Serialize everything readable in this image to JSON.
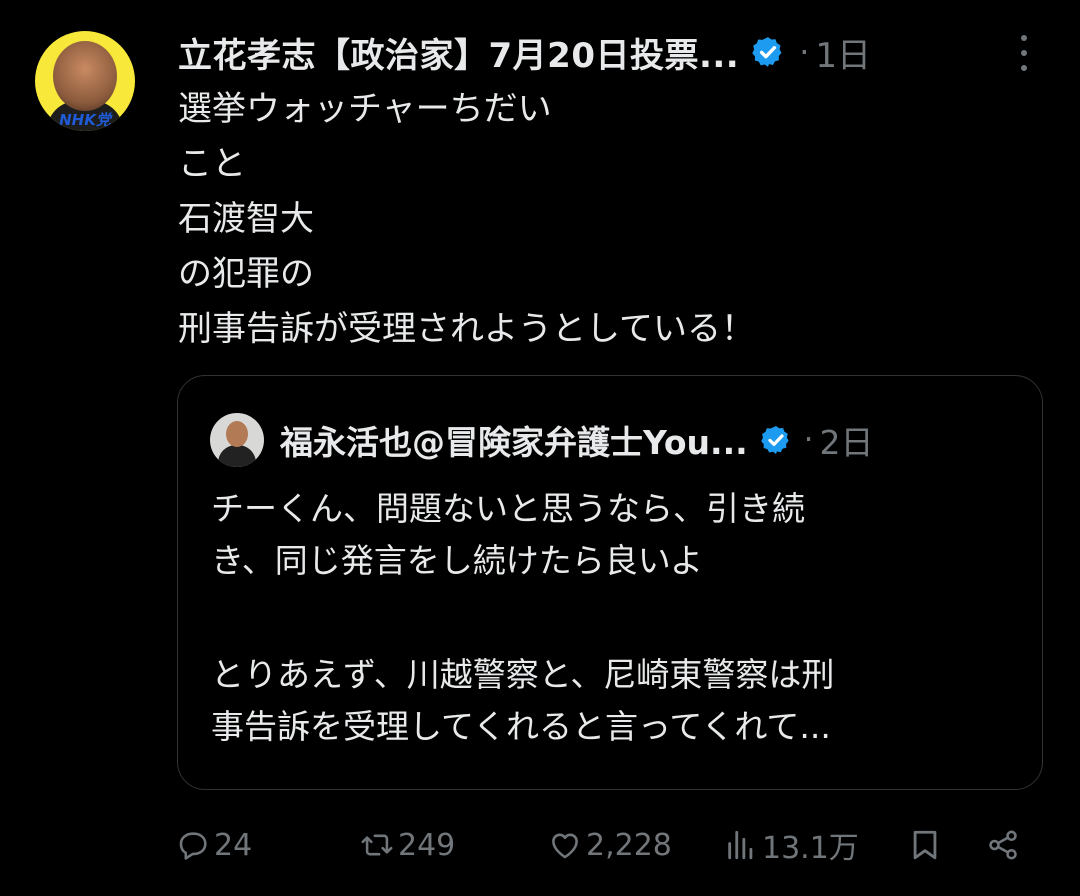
{
  "post": {
    "author_name": "立花孝志【政治家】7月20日投票...",
    "avatar_badge": "NHK党",
    "dot": "·",
    "time": "1日",
    "lines": [
      "選挙ウォッチャーちだい",
      "こと",
      "石渡智大",
      "の犯罪の",
      "刑事告訴が受理されようとしている！"
    ]
  },
  "quote": {
    "author_name": "福永活也@冒険家弁護士You...",
    "dot": "·",
    "time": "2日",
    "paragraph1": [
      "チーくん、問題ないと思うなら、引き続",
      "き、同じ発言をし続けたら良いよ"
    ],
    "paragraph2": [
      "とりあえず、川越警察と、尼崎東警察は刑",
      "事告訴を受理してくれると言ってくれて..."
    ]
  },
  "actions": {
    "reply_count": "24",
    "repost_count": "249",
    "like_count": "2,228",
    "views_count": "13.1万"
  },
  "icons": [
    "verified-icon",
    "more-icon",
    "reply-icon",
    "repost-icon",
    "like-icon",
    "views-icon",
    "bookmark-icon",
    "share-icon"
  ],
  "colors": {
    "background": "#000000",
    "text": "#e7e9ea",
    "muted": "#71767b",
    "verified": "#1d9bf0",
    "border": "#2f3336"
  }
}
